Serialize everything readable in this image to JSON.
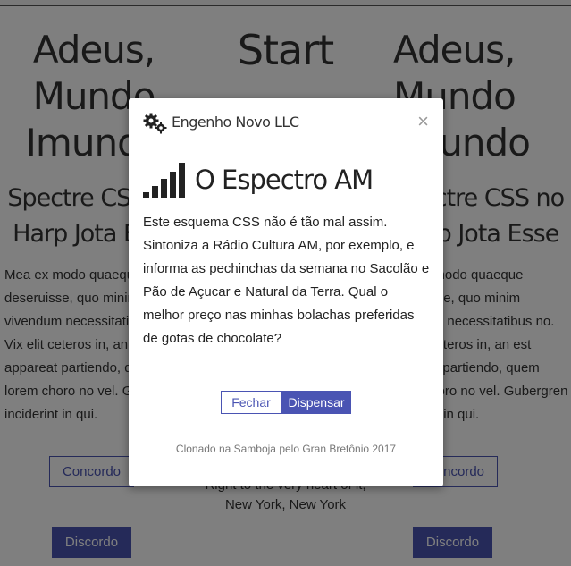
{
  "page": {
    "left_column": {
      "title": "Adeus, Mundo Imundo",
      "subtitle": "Spectre CSS no Harp Jota Esse",
      "text": "Mea ex modo quaeque deseruisse, quo minim vivendum necessitatibus no. Vix elit ceteros in, an est appareat partiendo, quem lorem choro no vel. Gubergren inciderint in qui.",
      "outline_button": "Concordo",
      "solid_button": "Discordo"
    },
    "middle_column": {
      "title": "Start",
      "footer_line1": "Right to the very heart of it,",
      "footer_line2": "New York, New York"
    },
    "right_column": {
      "title": "Adeus, Mundo Imundo",
      "subtitle": "Spectre CSS no Harp Jota Esse",
      "text": "Mea ex modo quaeque deseruisse, quo minim vivendum necessitatibus no. Vix elit ceteros in, an est appareat partiendo, quem lorem choro no vel. Gubergren inciderint in qui.",
      "outline_button": "Concordo",
      "solid_button": "Discordo"
    }
  },
  "modal": {
    "brand": "Engenho Novo LLC",
    "close": "×",
    "title": "O Espectro AM",
    "text": "Este esquema CSS não é tão mal assim. Sintoniza a Rádio Cultura AM, por exemplo, e informa as pechinchas da semana no Sacolão e Pão de Açucar e Natural da Terra. Qual o melhor preço nas minhas bolachas preferidas de gotas de chocolate?",
    "close_button": "Fechar",
    "dismiss_button": "Dispensar",
    "footer": "Clonado na Samboja pelo Gran Bretônio 2017"
  },
  "icons": {
    "brand": "gears-icon",
    "title": "signal-bars-icon"
  },
  "colors": {
    "accent": "#4a54b3",
    "overlay": "rgba(0,0,0,0.5)"
  }
}
